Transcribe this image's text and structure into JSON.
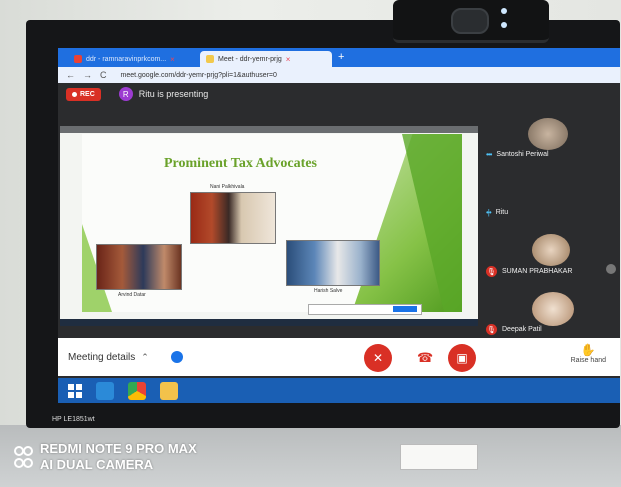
{
  "browser": {
    "tabs": [
      {
        "label": "ddr - ramnaravinprkcom..."
      },
      {
        "label": "Meet - ddr-yemr-prjg"
      }
    ],
    "url": "meet.google.com/ddr-yemr-prjg?pli=1&authuser=0",
    "nav": {
      "back": "←",
      "forward": "→",
      "reload": "C"
    }
  },
  "meet": {
    "rec_label": "REC",
    "presenter_initial": "R",
    "presenting_text": "Ritu is presenting",
    "slide": {
      "title": "Prominent Tax Advocates",
      "captions": [
        "Nani Palkhivala",
        "Arvind Datar",
        "Harish Salve"
      ]
    },
    "participants": [
      {
        "name": "Santoshi Periwal",
        "status": "speaking"
      },
      {
        "name": "Ritu",
        "status": "speaking"
      },
      {
        "name": "SUMAN PRABHAKAR",
        "status": "muted"
      },
      {
        "name": "Deepak Patil",
        "status": "muted"
      }
    ],
    "bottom_bar": {
      "meeting_details": "Meeting details",
      "raise_hand": "Raise hand"
    }
  },
  "device": {
    "monitor_brand": "HP LE1851wt",
    "watermark_line1": "REDMI NOTE 9 PRO MAX",
    "watermark_line2": "AI DUAL CAMERA"
  },
  "colors": {
    "accent": "#1a73e8",
    "danger": "#d93025",
    "taskbar": "#1a5fb4",
    "slide_green": "#6aa22a"
  }
}
